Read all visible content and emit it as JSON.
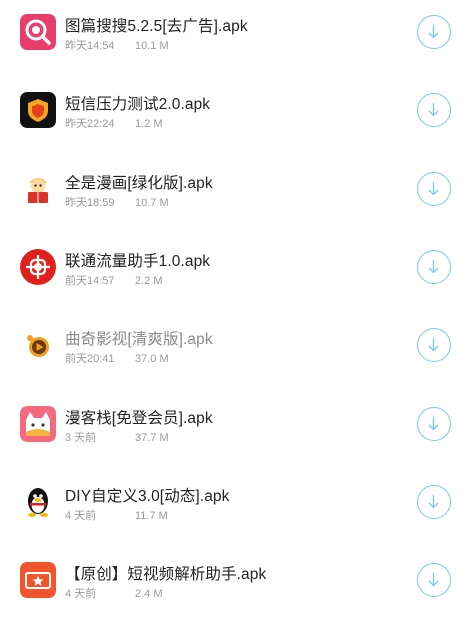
{
  "downloads": [
    {
      "name": "图篇搜搜5.2.5[去广告].apk",
      "time": "昨天14:54",
      "size": "10.1 M",
      "icon": "magnifier-app-icon",
      "dim": false
    },
    {
      "name": "短信压力测试2.0.apk",
      "time": "昨天22:24",
      "size": "1.2 M",
      "icon": "shield-app-icon",
      "dim": false
    },
    {
      "name": "全是漫画[绿化版].apk",
      "time": "昨天18:59",
      "size": "10.7 M",
      "icon": "comic-reader-app-icon",
      "dim": false
    },
    {
      "name": "联通流量助手1.0.apk",
      "time": "前天14:57",
      "size": "2.2 M",
      "icon": "china-unicom-app-icon",
      "dim": false
    },
    {
      "name": "曲奇影视[清爽版].apk",
      "time": "前天20:41",
      "size": "37.0 M",
      "icon": "cookie-play-app-icon",
      "dim": true
    },
    {
      "name": "漫客栈[免登会员].apk",
      "time": "3 天前",
      "size": "37.7 M",
      "icon": "cat-comic-app-icon",
      "dim": false
    },
    {
      "name": "DIY自定义3.0[动态].apk",
      "time": "4 天前",
      "size": "11.7 M",
      "icon": "penguin-app-icon",
      "dim": false
    },
    {
      "name": "【原创】短视频解析助手.apk",
      "time": "4 天前",
      "size": "2.4 M",
      "icon": "video-star-app-icon",
      "dim": false
    }
  ],
  "download_button_icon": "download-arrow-icon",
  "accent_color": "#78c8ee"
}
